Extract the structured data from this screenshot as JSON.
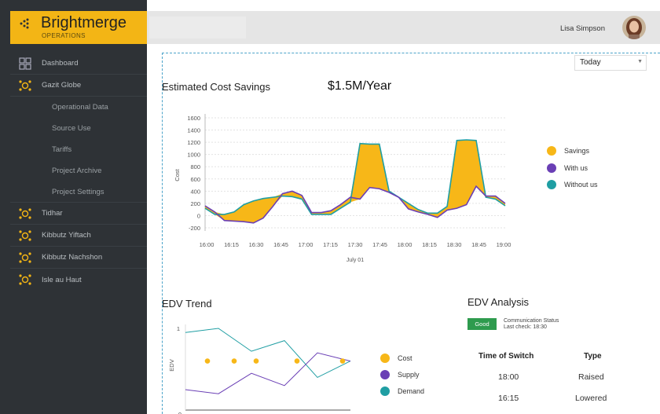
{
  "brand": {
    "name": "Brightmerge",
    "subtitle": "OPERATIONS"
  },
  "nav": {
    "dashboard": "Dashboard",
    "gazit": "Gazit Globe",
    "sub": [
      "Operational Data",
      "Source Use",
      "Tariffs",
      "Project Archive",
      "Project Settings"
    ],
    "sites": [
      "Tidhar",
      "Kibbutz Yiftach",
      "Kibbutz Nachshon",
      "Isle au Haut"
    ]
  },
  "user": {
    "name": "Lisa Simpson"
  },
  "period_select": {
    "value": "Today"
  },
  "savings": {
    "title": "Estimated Cost Savings",
    "value": "$1.5M/Year"
  },
  "edv_trend": {
    "title": "EDV Trend"
  },
  "edv_analysis": {
    "title": "EDV Analysis",
    "status_badge": "Good",
    "status_label": "Communication Status",
    "last_check": "Last check: 18:30",
    "col_time": "Time of Switch",
    "col_type": "Type",
    "rows": [
      {
        "time": "18:00",
        "type": "Raised"
      },
      {
        "time": "16:15",
        "type": "Lowered"
      }
    ]
  },
  "colors": {
    "accent": "#f3b515",
    "savings": "#f7b718",
    "with_us": "#6a3fb5",
    "without_us": "#1f9ea3",
    "good": "#2e9b4e"
  },
  "chart_data": [
    {
      "type": "line",
      "title": "",
      "xlabel": "July 01",
      "ylabel": "Cost",
      "ylim": [
        -200,
        1600
      ],
      "yticks": [
        "1600",
        "1400",
        "1200",
        "1000",
        "800",
        "600",
        "400",
        "200",
        "0",
        "-200"
      ],
      "xticks": [
        "16:00",
        "16:15",
        "16:30",
        "16:45",
        "17:00",
        "17:15",
        "17:30",
        "17:45",
        "18:00",
        "18:15",
        "18:30",
        "18:45",
        "19:00"
      ],
      "legend": "right",
      "series": [
        {
          "name": "With us",
          "values": [
            160,
            60,
            -80,
            -90,
            -100,
            -120,
            -40,
            150,
            360,
            400,
            330,
            50,
            50,
            80,
            180,
            300,
            270,
            460,
            440,
            380,
            300,
            110,
            60,
            20,
            -30,
            90,
            120,
            180,
            480,
            320,
            320,
            200
          ]
        },
        {
          "name": "Without us",
          "values": [
            120,
            20,
            20,
            60,
            180,
            240,
            280,
            300,
            320,
            310,
            270,
            20,
            20,
            20,
            120,
            220,
            1180,
            1170,
            1170,
            400,
            300,
            200,
            100,
            40,
            40,
            150,
            1230,
            1240,
            1230,
            300,
            270,
            160
          ]
        },
        {
          "name": "Savings",
          "values": [
            40,
            40,
            -100,
            -150,
            -280,
            -360,
            -320,
            -150,
            40,
            90,
            60,
            30,
            30,
            60,
            60,
            80,
            -910,
            -710,
            -730,
            -20,
            0,
            -90,
            -40,
            -20,
            -70,
            -60,
            -1110,
            -1060,
            -750,
            20,
            50,
            40
          ]
        }
      ]
    },
    {
      "type": "line",
      "title": "",
      "xlabel": "",
      "ylabel": "EDV",
      "ylim": [
        0,
        1
      ],
      "yticks": [
        "1",
        "0"
      ],
      "legend": "right",
      "series": [
        {
          "name": "Cost",
          "values": [
            0.6,
            0.6,
            0.6,
            0.6,
            0.6,
            0.6
          ]
        },
        {
          "name": "Supply",
          "values": [
            0.25,
            0.2,
            0.45,
            0.3,
            0.7,
            0.6
          ]
        },
        {
          "name": "Demand",
          "values": [
            0.95,
            1.0,
            0.72,
            0.85,
            0.4,
            0.6
          ]
        }
      ]
    }
  ]
}
